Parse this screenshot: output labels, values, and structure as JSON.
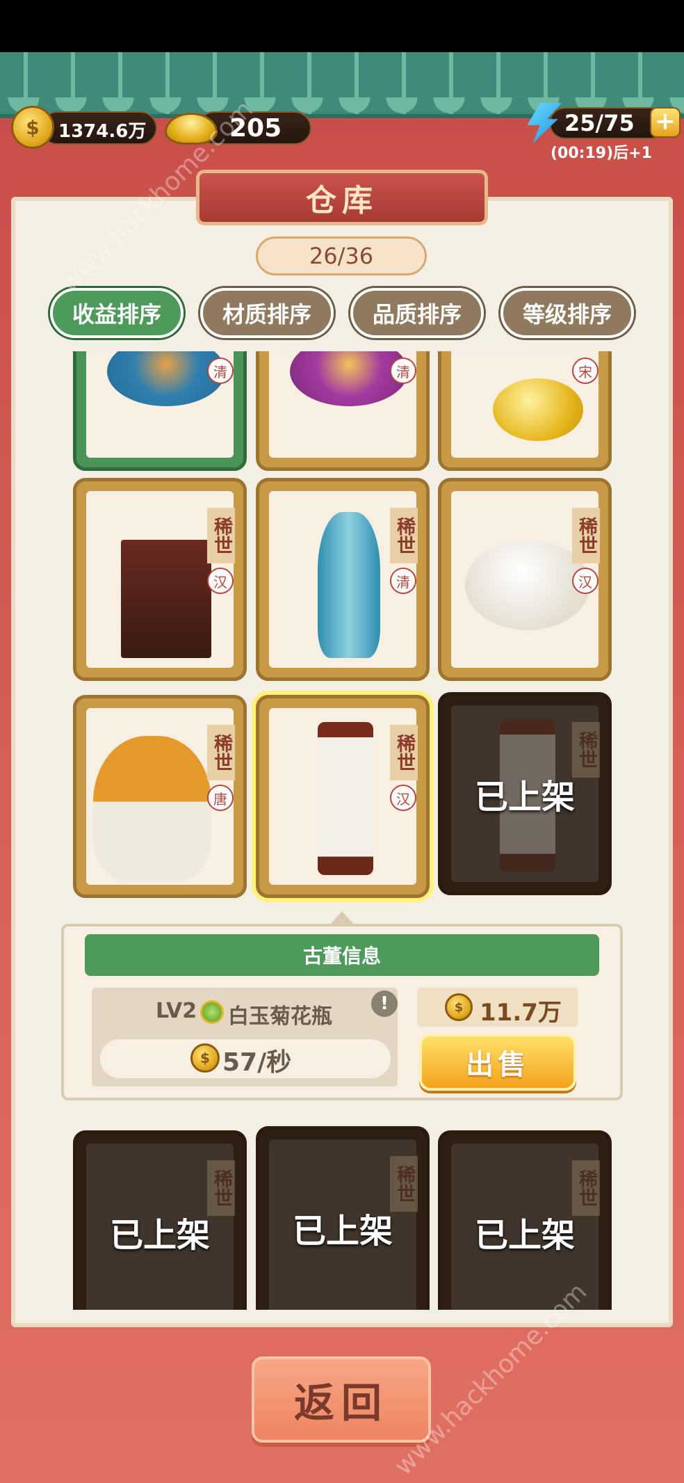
{
  "status": {
    "coins": "1374.6万",
    "ingots": "205",
    "energy": "25/75",
    "energy_timer": "(00:19)后+1"
  },
  "panel": {
    "title": "仓库",
    "capacity": "26/36"
  },
  "sort_tabs": [
    {
      "label": "收益排序",
      "active": true
    },
    {
      "label": "材质排序",
      "active": false
    },
    {
      "label": "品质排序",
      "active": false
    },
    {
      "label": "等级排序",
      "active": false
    }
  ],
  "cards": [
    {
      "rarity": "",
      "era": "清",
      "shelved": false,
      "art": "cloisonne-vase-blue"
    },
    {
      "rarity": "",
      "era": "清",
      "shelved": false,
      "art": "cloisonne-vase-purple"
    },
    {
      "rarity": "",
      "era": "宋",
      "shelved": false,
      "art": "gold-teapot"
    },
    {
      "rarity": "稀世",
      "era": "汉",
      "shelved": false,
      "art": "bronze-censer"
    },
    {
      "rarity": "稀世",
      "era": "清",
      "shelved": false,
      "art": "cloisonne-tall-vase"
    },
    {
      "rarity": "稀世",
      "era": "汉",
      "shelved": false,
      "art": "white-teapot"
    },
    {
      "rarity": "稀世",
      "era": "唐",
      "shelved": false,
      "art": "buddha-head"
    },
    {
      "rarity": "稀世",
      "era": "汉",
      "shelved": false,
      "art": "jade-chrysanthemum-vase"
    },
    {
      "rarity": "稀世",
      "era": "",
      "shelved": true,
      "shelved_label": "已上架",
      "art": "jade-vase-dark"
    },
    {
      "rarity": "稀世",
      "era": "",
      "shelved": true,
      "shelved_label": "已上架",
      "art": "bronze-lion-censer"
    },
    {
      "rarity": "稀世",
      "era": "",
      "shelved": true,
      "shelved_label": "已上架",
      "art": "jade-dragon"
    },
    {
      "rarity": "稀世",
      "era": "",
      "shelved": true,
      "shelved_label": "已上架",
      "art": "red-cup"
    }
  ],
  "info": {
    "header": "古董信息",
    "level": "LV2",
    "name": "白玉菊花瓶",
    "rate": "57/秒",
    "price": "11.7万",
    "sell_label": "出售",
    "alert": "!"
  },
  "back_label": "返回",
  "watermark": "www.hackhome.com",
  "colors": {
    "tab_active": "#4e9a5a",
    "tab_inactive": "#8f7a5f",
    "frame_gold": "#c89a45",
    "sell_button": "#f3a31a"
  }
}
